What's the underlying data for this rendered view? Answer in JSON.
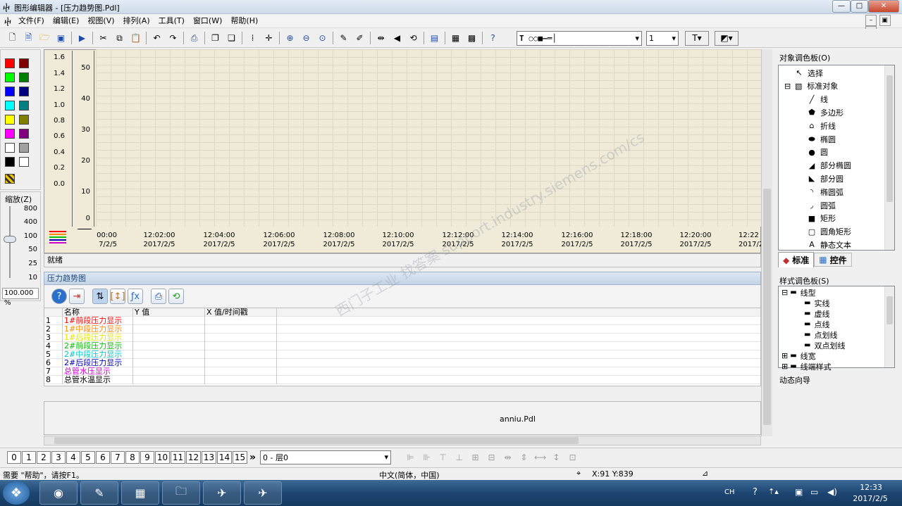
{
  "window": {
    "title": "图形编辑器 - [压力趋势图.Pdl]",
    "app_icon": "pin-icon",
    "min": "—",
    "max": "□",
    "close": "✕",
    "inner_min": "–",
    "inner_restore": "▣",
    "inner_close": "✕"
  },
  "menu": [
    "文件(F)",
    "编辑(E)",
    "视图(V)",
    "排列(A)",
    "工具(T)",
    "窗口(W)",
    "帮助(H)"
  ],
  "toolbar": {
    "font_combo": "T ◌◌■—═│",
    "size_combo": "1"
  },
  "palette_colors": [
    "#ff0000",
    "#800000",
    "#00ff00",
    "#008000",
    "#0000ff",
    "#000080",
    "#00ffff",
    "#008080",
    "#ffff00",
    "#808000",
    "#ff00ff",
    "#800080",
    "#ffffff",
    "#a0a0a0",
    "#000000",
    "#ffffff"
  ],
  "zoom": {
    "label": "缩放(Z)",
    "levels": [
      "800",
      "400",
      "100",
      "50",
      "25",
      "10"
    ],
    "current": "100.000 %"
  },
  "trend": {
    "left_axis": [
      "1.6",
      "1.4",
      "1.2",
      "1.0",
      "0.8",
      "0.6",
      "0.4",
      "0.2",
      "0.0"
    ],
    "right_axis": [
      "50",
      "40",
      "30",
      "20",
      "10",
      "0"
    ],
    "times": [
      "00:00",
      "12:02:00",
      "12:04:00",
      "12:06:00",
      "12:08:00",
      "12:10:00",
      "12:12:00",
      "12:14:00",
      "12:16:00",
      "12:18:00",
      "12:20:00",
      "12:22"
    ],
    "dates": [
      "7/2/5",
      "2017/2/5",
      "2017/2/5",
      "2017/2/5",
      "2017/2/5",
      "2017/2/5",
      "2017/2/5",
      "2017/2/5",
      "2017/2/5",
      "2017/2/5",
      "2017/2/5",
      "2017/2"
    ]
  },
  "ready": "就绪",
  "lower_title": "压力趋势图",
  "table": {
    "headers": [
      "名称",
      "Y 值",
      "X 值/时间戳"
    ],
    "rows": [
      {
        "n": "1",
        "name": "1#前段压力显示",
        "color": "#ff0000"
      },
      {
        "n": "2",
        "name": "1#中段压力显示",
        "color": "#ff8c00"
      },
      {
        "n": "3",
        "name": "1#后段压力显示",
        "color": "#e6e600"
      },
      {
        "n": "4",
        "name": "2#前段压力显示",
        "color": "#00c000"
      },
      {
        "n": "5",
        "name": "2#中段压力显示",
        "color": "#00c8c8"
      },
      {
        "n": "6",
        "name": "2#后段压力显示",
        "color": "#0000c0"
      },
      {
        "n": "7",
        "name": "总管水压显示",
        "color": "#d000d0"
      },
      {
        "n": "8",
        "name": "总管水温显示",
        "color": "#000000"
      }
    ]
  },
  "doc_tab": "anniu.Pdl",
  "object_palette": {
    "title": "对象调色板(O)",
    "items": [
      {
        "label": "选择",
        "icon": "↖",
        "indent": 22
      },
      {
        "label": "标准对象",
        "icon": "▧",
        "indent": 8
      },
      {
        "label": "线",
        "icon": "╱",
        "indent": 40
      },
      {
        "label": "多边形",
        "icon": "⬟",
        "indent": 40
      },
      {
        "label": "折线",
        "icon": "⌂",
        "indent": 40
      },
      {
        "label": "椭圆",
        "icon": "⬬",
        "indent": 40
      },
      {
        "label": "圆",
        "icon": "●",
        "indent": 40
      },
      {
        "label": "部分椭圆",
        "icon": "◢",
        "indent": 40
      },
      {
        "label": "部分圆",
        "icon": "◣",
        "indent": 40
      },
      {
        "label": "椭圆弧",
        "icon": "◝",
        "indent": 40
      },
      {
        "label": "圆弧",
        "icon": "◞",
        "indent": 40
      },
      {
        "label": "矩形",
        "icon": "■",
        "indent": 40
      },
      {
        "label": "圆角矩形",
        "icon": "▢",
        "indent": 40
      },
      {
        "label": "静态文本",
        "icon": "A",
        "indent": 40
      }
    ],
    "tab_standard": "标准",
    "tab_controls": "控件"
  },
  "style_palette": {
    "title": "样式调色板(S)",
    "items": [
      {
        "label": "线型",
        "indent": 4
      },
      {
        "label": "实线",
        "indent": 36
      },
      {
        "label": "虚线",
        "indent": 36
      },
      {
        "label": "点线",
        "indent": 36
      },
      {
        "label": "点划线",
        "indent": 36
      },
      {
        "label": "双点划线",
        "indent": 36
      },
      {
        "label": "线宽",
        "indent": 4
      },
      {
        "label": "线端样式",
        "indent": 4
      }
    ]
  },
  "dynamic_wizard": "动态向导",
  "layers": {
    "buttons": [
      "0",
      "1",
      "2",
      "3",
      "4",
      "5",
      "6",
      "7",
      "8",
      "9",
      "10",
      "11",
      "12",
      "13",
      "14",
      "15"
    ],
    "more": "»",
    "combo": "0 - 层0"
  },
  "statusbar": {
    "help": "需要 \"帮助\"，请按F1。",
    "lang": "中文(简体，中国)",
    "coords": "X:91 Y:839"
  },
  "taskbar": {
    "lang_indicator": "CH",
    "time": "12:33",
    "date": "2017/2/5"
  },
  "watermark": "西门子工业 找答案 support.industry.siemens.com/cs"
}
